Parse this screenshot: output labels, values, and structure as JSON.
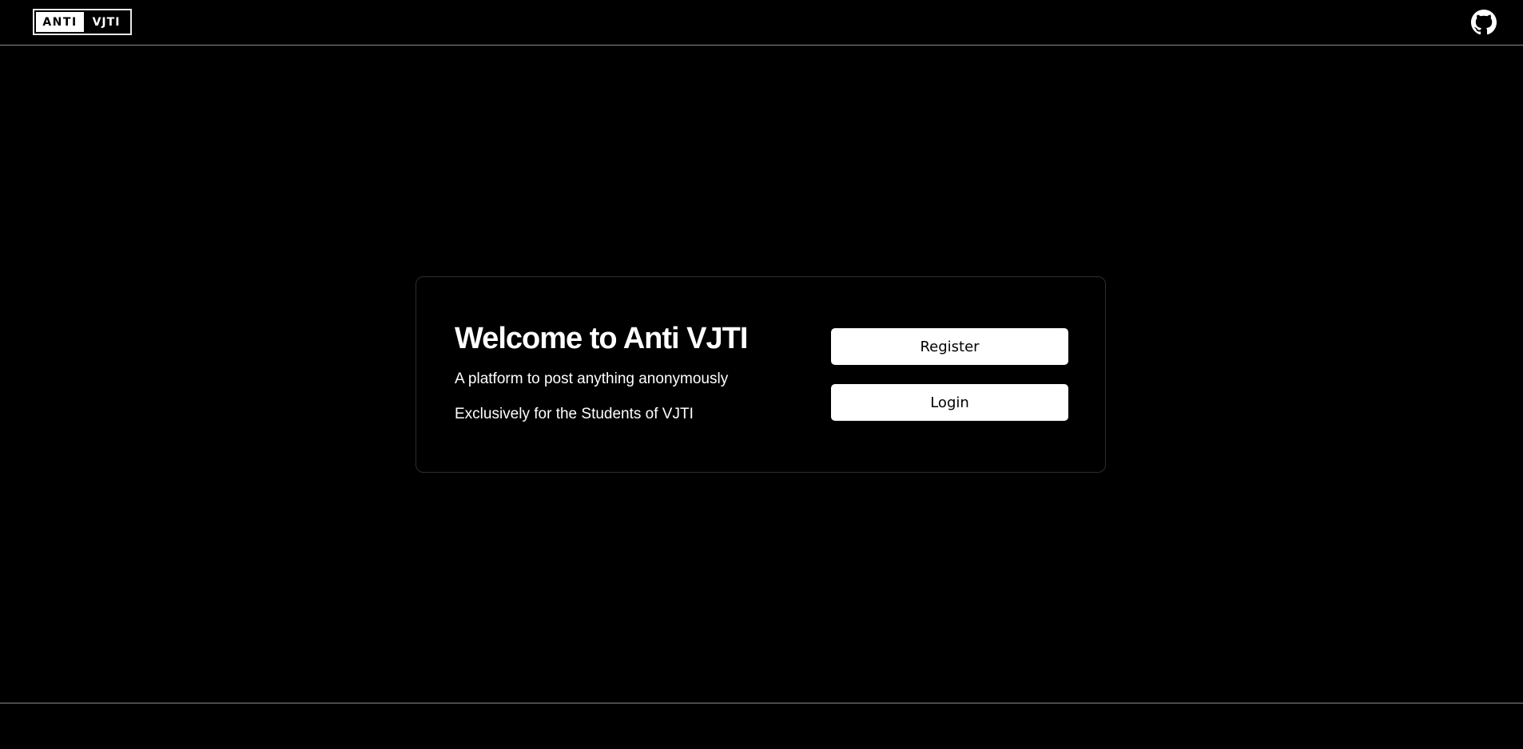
{
  "header": {
    "logo": {
      "part1": "ANTI",
      "part2": "VJTI"
    },
    "github_icon": "github-icon"
  },
  "card": {
    "title": "Welcome to Anti VJTI",
    "subtitle1": "A platform to post anything anonymously",
    "subtitle2": "Exclusively for the Students of VJTI",
    "register_label": "Register",
    "login_label": "Login"
  },
  "colors": {
    "background": "#000000",
    "text": "#ffffff",
    "button_bg": "#ffffff",
    "button_text": "#000000",
    "divider": "#8a8a8a"
  }
}
